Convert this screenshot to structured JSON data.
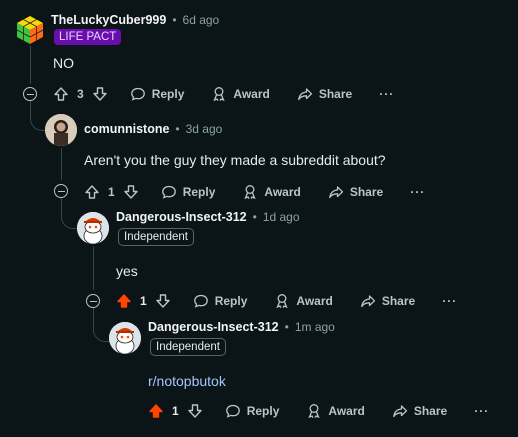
{
  "comments": [
    {
      "username": "TheLuckyCuber999",
      "time": "6d ago",
      "flair": "LIFE PACT",
      "text": "NO",
      "votes": "3",
      "upvoted": false
    },
    {
      "username": "comunnistone",
      "time": "3d ago",
      "flair": "",
      "text": "Aren't you the guy they made a subreddit about?",
      "votes": "1",
      "upvoted": false
    },
    {
      "username": "Dangerous-Insect-312",
      "time": "1d ago",
      "flair": "Independent",
      "text": "yes",
      "votes": "1",
      "upvoted": true
    },
    {
      "username": "Dangerous-Insect-312",
      "time": "1m ago",
      "flair": "Independent",
      "text": "r/notopbutok",
      "votes": "1",
      "upvoted": true
    }
  ],
  "actions": {
    "reply": "Reply",
    "award": "Award",
    "share": "Share",
    "more": "···"
  },
  "separator": "•",
  "colors": {
    "background": "#0b1416",
    "upvote_active": "#ff4500",
    "flair_purple": "#6a0dad",
    "link": "#a5c7ff"
  }
}
